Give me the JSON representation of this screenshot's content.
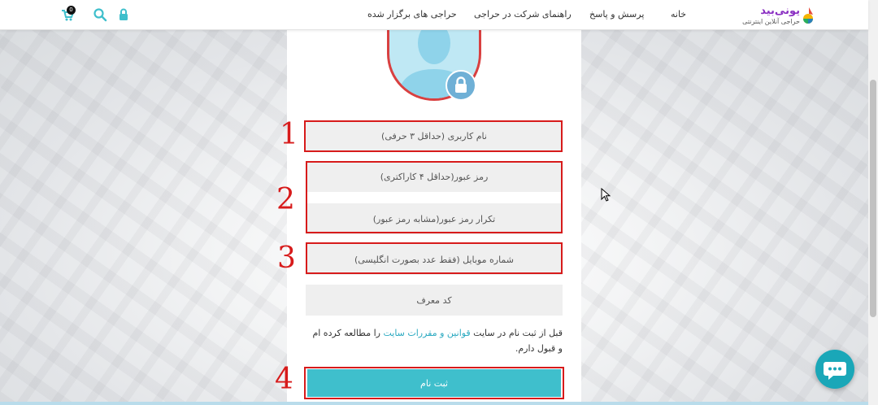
{
  "header": {
    "logo": {
      "title": "یونی‌بید",
      "subtitle": "حراجی آنلاین اینترنتی"
    },
    "nav": [
      "خانه",
      "پرسش و پاسخ",
      "راهنمای شرکت در حراجی",
      "حراجی های برگزار شده"
    ],
    "icons": [
      "lock-icon",
      "search-icon",
      "cart-icon"
    ],
    "cart_count": "0"
  },
  "form": {
    "username_placeholder": "نام کاربری (حداقل ۳ حرفی)",
    "password_placeholder": "رمز عبور(حداقل ۴ کاراکتری)",
    "password_repeat_placeholder": "تکرار رمز عبور(مشابه رمز عبور)",
    "mobile_placeholder": "شماره موبایل (فقط عدد بصورت انگلیسی)",
    "referral_placeholder": "کد معرف",
    "terms_before": "قبل از ثبت نام در سایت ",
    "terms_link": "قوانین و مقررات سایت",
    "terms_after": " را مطالعه کرده ام و قبول دارم.",
    "submit_label": "ثبت نام"
  },
  "annotations": {
    "n1": "1",
    "n2": "2",
    "n3": "3",
    "n4": "4"
  },
  "colors": {
    "accent": "#3fbfcc",
    "annotation": "#d71b1b",
    "logo": "#8a2fc2",
    "link": "#2aa9c0"
  }
}
